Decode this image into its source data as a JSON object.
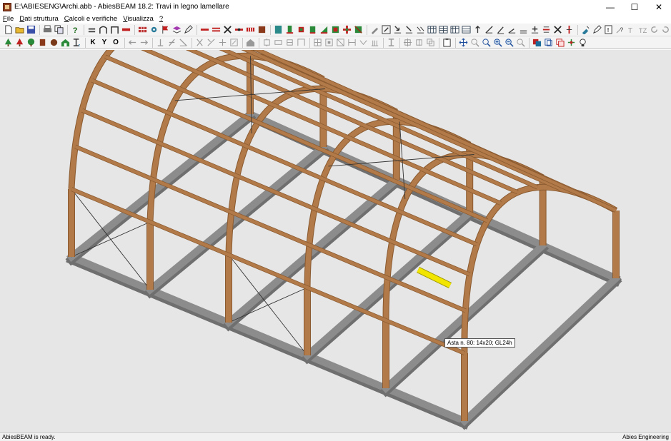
{
  "window": {
    "title": "E:\\ABIESENG\\Archi.abb - AbiesBEAM 18.2: Travi in legno lamellare",
    "minimize_glyph": "—",
    "maximize_glyph": "☐",
    "close_glyph": "✕"
  },
  "menu": [
    {
      "key": "F",
      "rest": "ile"
    },
    {
      "key": "D",
      "rest": "ati struttura"
    },
    {
      "key": "C",
      "rest": "alcoli e verifiche"
    },
    {
      "key": "V",
      "rest": "isualizza"
    },
    {
      "key": "?",
      "rest": ""
    }
  ],
  "toolbar2_letters": {
    "k": "K",
    "y": "Y",
    "o": "O"
  },
  "tooltip": {
    "text": "Asta n. 80: 14x20; GL24h"
  },
  "status": {
    "left": "AbiesBEAM is ready.",
    "right": "Abies Engineering"
  },
  "colors": {
    "viewport_bg": "#e6e6e6",
    "wood": "#b27a48",
    "wood_dark": "#8a5a30",
    "foundation": "#8c8c8c",
    "foundation_dark": "#6f6f6f",
    "selected_beam": "#f2e600"
  }
}
